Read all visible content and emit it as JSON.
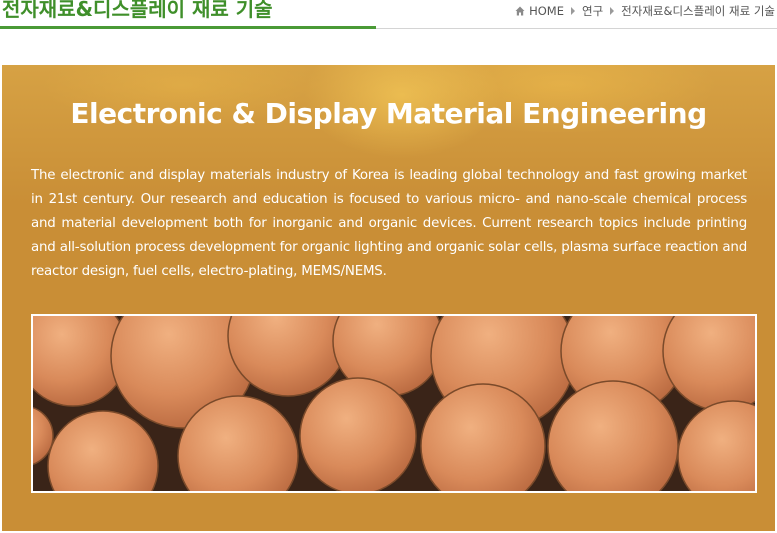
{
  "header": {
    "title": "전자재료&디스플레이 재료 기술",
    "breadcrumb": {
      "home": "HOME",
      "section": "연구",
      "current": "전자재료&디스플레이 재료 기술"
    }
  },
  "hero": {
    "heading": "Electronic & Display Material Engineering",
    "body": "The electronic and display materials industry of Korea is leading global technology and fast growing market in 21st century. Our research and education is focused to various micro- and nano-scale chemical process and material development both for inorganic and organic devices. Current research topics include printing and all-solution process development for organic lighting and organic solar cells, plasma surface reaction and reactor design, fuel cells, electro-plating, MEMS/NEMS."
  },
  "colors": {
    "title_green": "#3f8f2a",
    "hero_background": "#c98e36",
    "sphere_fill": "#d98a5a",
    "image_background": "#3a2418"
  },
  "icons": {
    "home": "home-icon",
    "separator": "triangle-right-icon"
  }
}
